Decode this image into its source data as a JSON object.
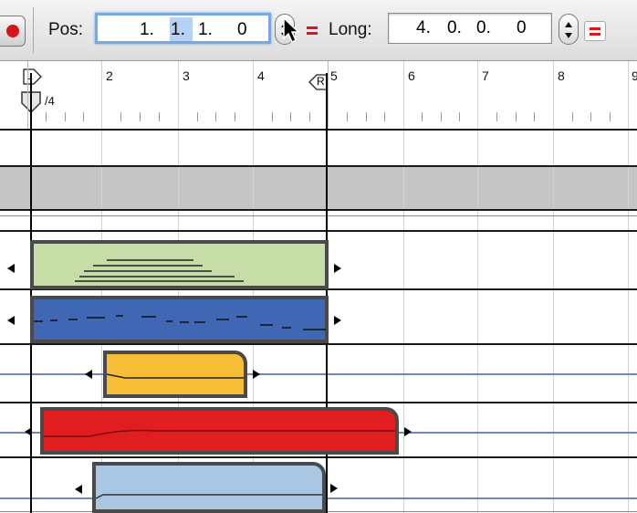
{
  "toolbar": {
    "pos_label": "Pos:",
    "pos_value": [
      "1.",
      "1.",
      "1.",
      "0"
    ],
    "long_label": "Long:",
    "long_value": [
      "4.",
      "0.",
      "0.",
      "0"
    ]
  },
  "ruler": {
    "bars": [
      "2",
      "3",
      "4",
      "5",
      "6",
      "7",
      "8"
    ],
    "left_locator": "L",
    "right_locator": "R",
    "time_signature": "/4"
  },
  "colors": {
    "green_region": "#c6dda8",
    "blue_region": "#3f67b3",
    "yellow_region": "#f6be36",
    "red_region": "#e01d21",
    "lightblue_region": "#a9c6e2"
  },
  "regions": [
    {
      "name": "green-region",
      "color": "green"
    },
    {
      "name": "blue-region",
      "color": "blue"
    },
    {
      "name": "yellow-region",
      "color": "yellow"
    },
    {
      "name": "red-region",
      "color": "red"
    },
    {
      "name": "lightblue-region",
      "color": "lightblue"
    }
  ]
}
